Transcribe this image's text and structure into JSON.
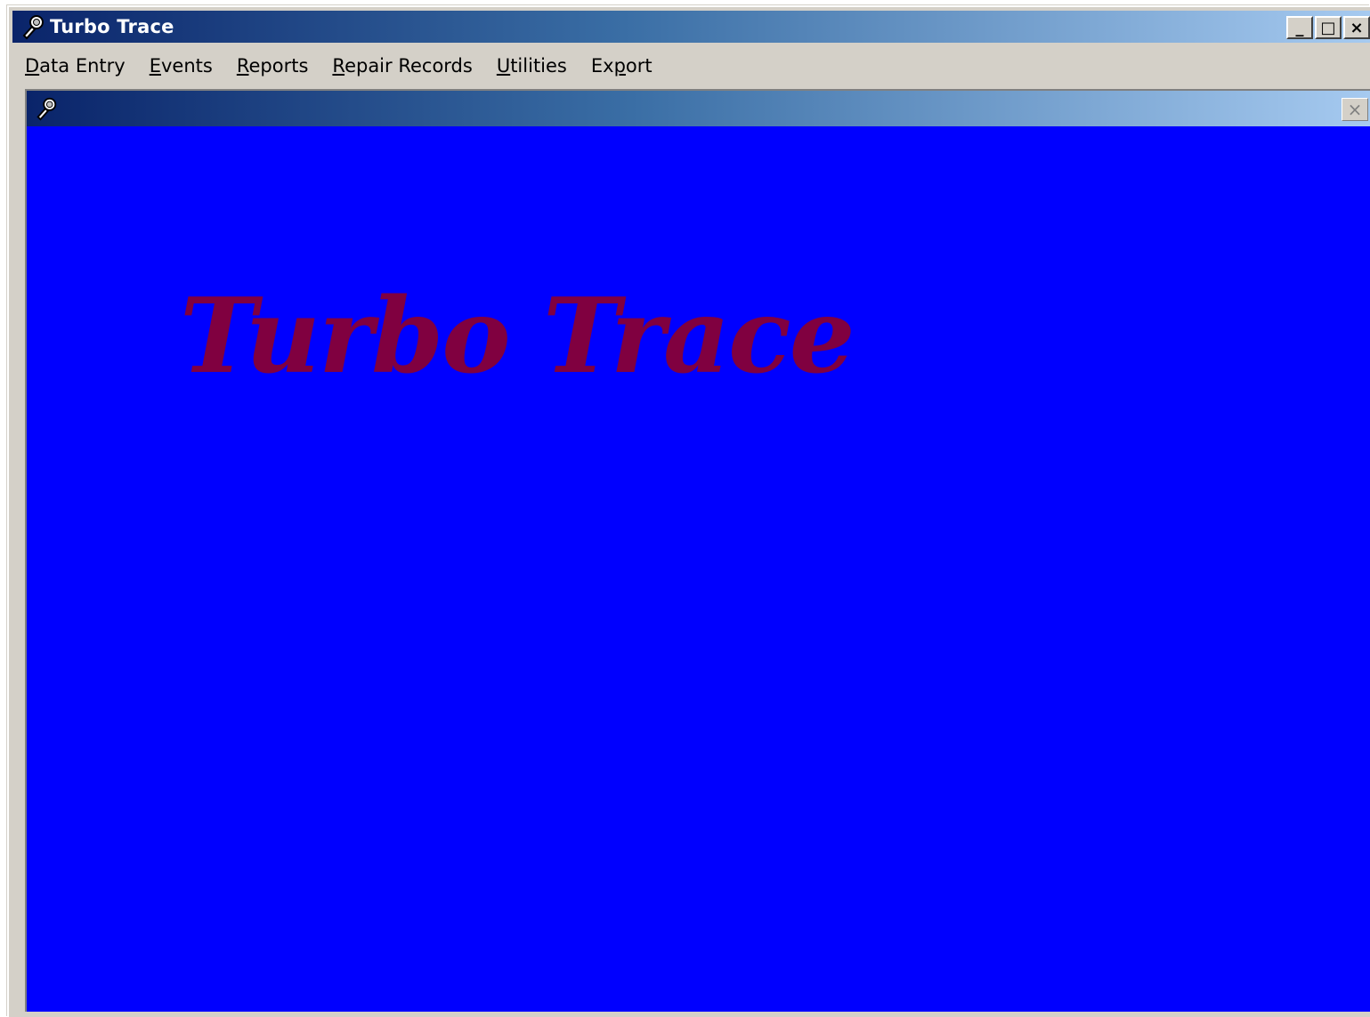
{
  "window": {
    "title": "Turbo Trace",
    "icon": "wrench-magnifier-icon",
    "caption_buttons": {
      "minimize": "_",
      "maximize": "□",
      "close": "×"
    }
  },
  "menubar": {
    "items": [
      {
        "pre": "",
        "accel": "D",
        "post": "ata Entry"
      },
      {
        "pre": "",
        "accel": "E",
        "post": "vents"
      },
      {
        "pre": "",
        "accel": "R",
        "post": "eports"
      },
      {
        "pre": "",
        "accel": "R",
        "post": "epair Records"
      },
      {
        "pre": "",
        "accel": "U",
        "post": "tilities"
      },
      {
        "pre": "Ex",
        "accel": "p",
        "post": "ort"
      }
    ]
  },
  "child_window": {
    "icon": "wrench-magnifier-icon",
    "close": "×",
    "background": "#0000ff",
    "splash_title": "Turbo Trace",
    "splash_color": "#800040"
  }
}
